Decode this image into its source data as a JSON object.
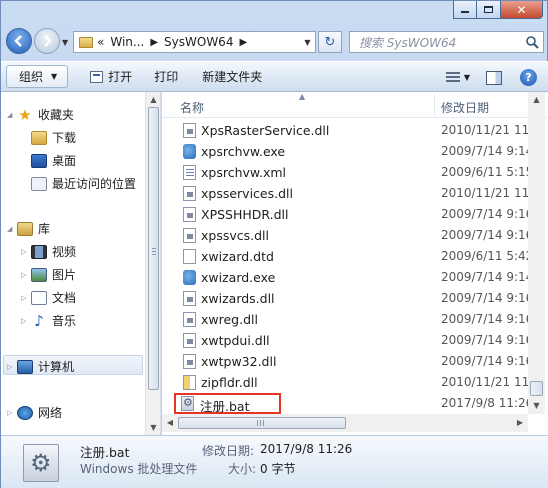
{
  "window": {
    "min_glyph": "—",
    "max_glyph": "□",
    "close_glyph": "✕"
  },
  "nav": {
    "address": {
      "prefix": "«",
      "segments": [
        "Win...",
        "SysWOW64"
      ]
    },
    "search_placeholder": "搜索 SysWOW64"
  },
  "toolbar": {
    "organize": "组织",
    "open": "打开",
    "print": "打印",
    "new_folder": "新建文件夹"
  },
  "navpane": {
    "favorites": {
      "label": "收藏夹",
      "items": [
        "下载",
        "桌面",
        "最近访问的位置"
      ]
    },
    "libraries": {
      "label": "库",
      "items": [
        "视频",
        "图片",
        "文档",
        "音乐"
      ]
    },
    "computer": "计算机",
    "network": "网络"
  },
  "filelist": {
    "columns": {
      "name": "名称",
      "modified": "修改日期"
    },
    "rows": [
      {
        "name": "XpsRasterService.dll",
        "date": "2010/11/21 11",
        "icon": "dll"
      },
      {
        "name": "xpsrchvw.exe",
        "date": "2009/7/14 9:14",
        "icon": "exe"
      },
      {
        "name": "xpsrchvw.xml",
        "date": "2009/6/11 5:15",
        "icon": "xml"
      },
      {
        "name": "xpsservices.dll",
        "date": "2010/11/21 11",
        "icon": "dll"
      },
      {
        "name": "XPSSHHDR.dll",
        "date": "2009/7/14 9:16",
        "icon": "dll"
      },
      {
        "name": "xpssvcs.dll",
        "date": "2009/7/14 9:16",
        "icon": "dll"
      },
      {
        "name": "xwizard.dtd",
        "date": "2009/6/11 5:42",
        "icon": "dtd"
      },
      {
        "name": "xwizard.exe",
        "date": "2009/7/14 9:14",
        "icon": "exe"
      },
      {
        "name": "xwizards.dll",
        "date": "2009/7/14 9:16",
        "icon": "dll"
      },
      {
        "name": "xwreg.dll",
        "date": "2009/7/14 9:16",
        "icon": "dll"
      },
      {
        "name": "xwtpdui.dll",
        "date": "2009/7/14 9:16",
        "icon": "dll"
      },
      {
        "name": "xwtpw32.dll",
        "date": "2009/7/14 9:16",
        "icon": "dll"
      },
      {
        "name": "zipfldr.dll",
        "date": "2010/11/21 11",
        "icon": "zip"
      },
      {
        "name": "注册.bat",
        "date": "2017/9/8 11:26",
        "icon": "bat",
        "highlighted": true
      }
    ]
  },
  "details": {
    "name": "注册.bat",
    "type": "Windows 批处理文件",
    "modified_label": "修改日期:",
    "modified_value": "2017/9/8 11:26",
    "size_label": "大小:",
    "size_value": "0 字节"
  },
  "colors": {
    "highlight_border": "#e53527",
    "window_frame": "#c9dcf2"
  }
}
